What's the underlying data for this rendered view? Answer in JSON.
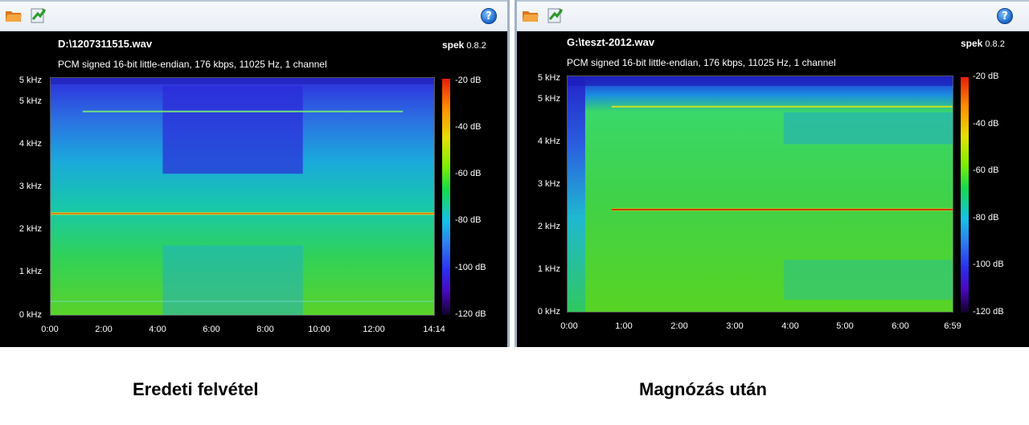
{
  "left": {
    "filename": "D:\\1207311515.wav",
    "app_name": "spek",
    "app_version": "0.8.2",
    "info": "PCM signed 16-bit little-endian, 176 kbps, 11025 Hz, 1 channel",
    "freq_labels": [
      "5 kHz",
      "5 kHz",
      "4 kHz",
      "3 kHz",
      "2 kHz",
      "1 kHz",
      "0 kHz"
    ],
    "time_labels": [
      "0:00",
      "2:00",
      "4:00",
      "6:00",
      "8:00",
      "10:00",
      "12:00",
      "14:14"
    ],
    "db_labels": [
      "-20 dB",
      "-40 dB",
      "-60 dB",
      "-80 dB",
      "-100 dB",
      "-120 dB"
    ],
    "caption": "Eredeti felvétel"
  },
  "right": {
    "filename": "G:\\teszt-2012.wav",
    "app_name": "spek",
    "app_version": "0.8.2",
    "info": "PCM signed 16-bit little-endian, 176 kbps, 11025 Hz, 1 channel",
    "freq_labels": [
      "5 kHz",
      "5 kHz",
      "4 kHz",
      "3 kHz",
      "2 kHz",
      "1 kHz",
      "0 kHz"
    ],
    "time_labels": [
      "0:00",
      "1:00",
      "2:00",
      "3:00",
      "4:00",
      "5:00",
      "6:00",
      "6:59"
    ],
    "db_labels": [
      "-20 dB",
      "-40 dB",
      "-60 dB",
      "-80 dB",
      "-100 dB",
      "-120 dB"
    ],
    "caption": "Magnózás után"
  },
  "icons": {
    "open": "open-folder-icon",
    "save": "save-image-icon",
    "help": "help-icon",
    "help_glyph": "?"
  }
}
